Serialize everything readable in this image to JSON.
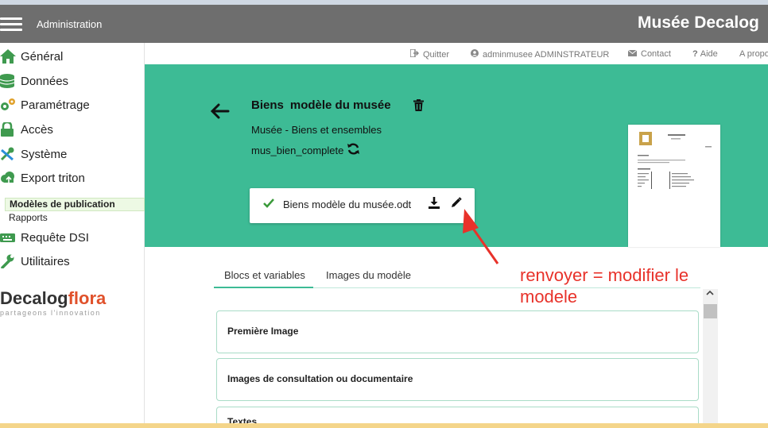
{
  "header": {
    "section_label": "Administration",
    "brand": "Musée Decalog"
  },
  "sidebar": {
    "items": [
      {
        "label": "Général",
        "icon": "home-icon"
      },
      {
        "label": "Données",
        "icon": "database-icon"
      },
      {
        "label": "Paramétrage",
        "icon": "gears-icon"
      },
      {
        "label": "Accès",
        "icon": "lock-icon"
      },
      {
        "label": "Système",
        "icon": "tools-icon"
      },
      {
        "label": "Export triton",
        "icon": "cloud-upload-icon"
      }
    ],
    "subitems": [
      {
        "label": "Modèles de publication",
        "active": true
      },
      {
        "label": "Rapports",
        "active": false
      }
    ],
    "items2": [
      {
        "label": "Requête DSI",
        "icon": "keyboard-icon"
      },
      {
        "label": "Utilitaires",
        "icon": "wrench-icon"
      }
    ],
    "logo_main": "Decalog",
    "logo_accent": "flora",
    "logo_tagline": "partageons l'innovation"
  },
  "utility_links": [
    {
      "label": "Quitter",
      "icon": "sign-out-icon"
    },
    {
      "label": "adminmusee ADMINSTRATEUR",
      "icon": "user-circle-icon"
    },
    {
      "label": "Contact",
      "icon": "envelope-icon"
    },
    {
      "label": "Aide",
      "icon": "question-icon"
    },
    {
      "label": "A propos",
      "icon": ""
    }
  ],
  "model": {
    "title_part1": "Biens",
    "title_part2": "modèle du musée",
    "subtitle": "Musée - Biens et ensembles",
    "code": "mus_bien_complete",
    "file_name": "Biens  modèle du musée.odt"
  },
  "tabs": [
    {
      "label": "Blocs et variables",
      "active": true
    },
    {
      "label": "Images du modèle",
      "active": false
    }
  ],
  "blocks": [
    {
      "label": "Première Image"
    },
    {
      "label": "Images de consultation ou documentaire"
    },
    {
      "label": "Textes"
    }
  ],
  "annotation": {
    "line1": "renvoyer = modifier le",
    "line2": "modele"
  },
  "colors": {
    "header_gray": "#6e6e6e",
    "panel_green": "#3dbb95",
    "annotation_red": "#e8322a",
    "accent_orange": "#e0512b"
  }
}
